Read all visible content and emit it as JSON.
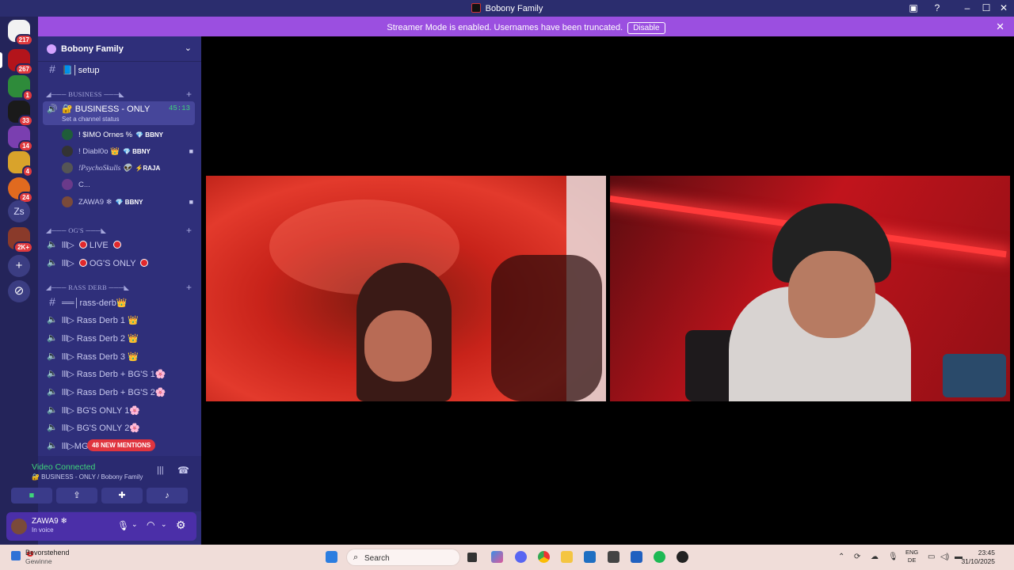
{
  "titlebar": {
    "title": "Bobony Family"
  },
  "banner": {
    "message": "Streamer Mode is enabled. Usernames have been truncated.",
    "disable": "Disable"
  },
  "rail": {
    "badges": [
      "217",
      "267",
      "1",
      "33",
      "14",
      "4",
      "24",
      "2K+"
    ],
    "text_server": "Zs"
  },
  "server": {
    "name": "Bobony Family"
  },
  "channels": {
    "setup": "📘│setup",
    "cat_business": "◢─── BUSINESS ───◣",
    "business_only": "🔐 BUSINESS - ONLY",
    "business_timer": "45:13",
    "set_status": "Set a channel status",
    "voice_users": [
      {
        "name": "! $IMO Ornes %",
        "tag": "💎 BBNY"
      },
      {
        "name": "! Diabl0o 👑",
        "tag": "💎 BBNY"
      },
      {
        "name": "!PsychoSkulls 👽",
        "tag": "⚡RAJA"
      },
      {
        "name": "C...",
        "tag": ""
      },
      {
        "name": "ZAWA9 ❄",
        "tag": "💎 BBNY"
      }
    ],
    "cat_ogs": "◢─── OG'S ───◣",
    "live": "LIVE",
    "ogs_only": "OG'S ONLY",
    "cat_rass": "◢─── RASS DERB ───◣",
    "rass_text": "══│rass-derb👑",
    "list": [
      "Rass Derb 1 👑",
      "Rass Derb 2 👑",
      "Rass Derb 3 👑",
      "Rass Derb + BG'S 1🌸",
      "Rass Derb + BG'S 2🌸",
      "BG'S ONLY 1🌸",
      "BG'S ONLY 2🌸",
      "MG'S"
    ],
    "prefix": "lll▷",
    "mentions": "48 NEW MENTIONS"
  },
  "voice": {
    "title": "Video Connected",
    "subtitle": "🔐 BUSINESS - ONLY / Bobony Family"
  },
  "user": {
    "name": "ZAWA9 ❄",
    "status": "In voice"
  },
  "taskbar": {
    "weather_title": "Bevorstehend",
    "weather_sub": "Gewinne",
    "weather_badge": "1",
    "search": "Search",
    "lang_top": "ENG",
    "lang_bottom": "DE",
    "time": "23:45",
    "date": "31/10/2025"
  },
  "colors": {
    "accent": "#9b4fe0",
    "sidebar": "#2f2f7a",
    "voice_green": "#3fd67a",
    "mention_red": "#e0353f"
  }
}
